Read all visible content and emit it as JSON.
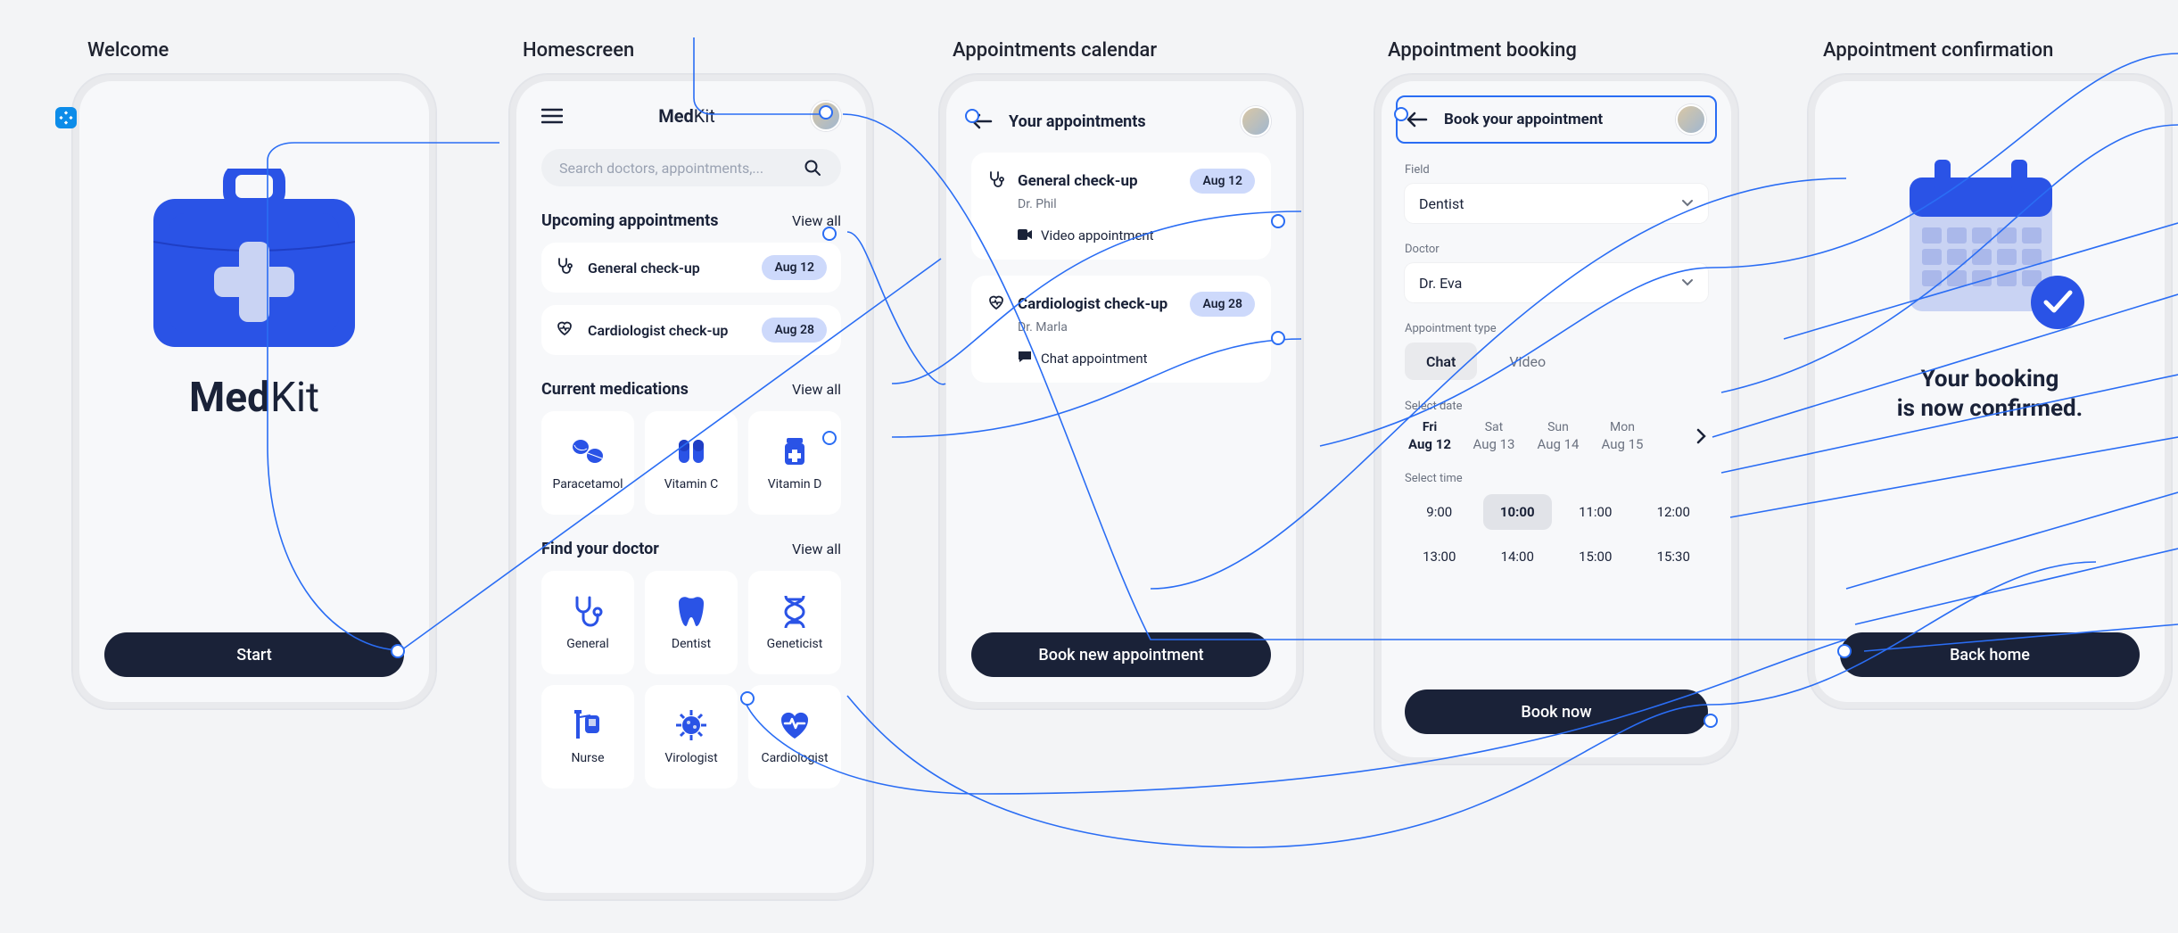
{
  "labels": {
    "welcome": "Welcome",
    "home": "Homescreen",
    "calendar": "Appointments calendar",
    "booking": "Appointment booking",
    "confirm": "Appointment confirmation"
  },
  "brand": {
    "med": "Med",
    "kit": "Kit"
  },
  "welcome": {
    "start": "Start"
  },
  "home": {
    "search_placeholder": "Search doctors, appointments,...",
    "upcoming_title": "Upcoming appointments",
    "view_all": "View all",
    "appt1": {
      "label": "General check-up",
      "date": "Aug 12"
    },
    "appt2": {
      "label": "Cardiologist check-up",
      "date": "Aug 28"
    },
    "meds_title": "Current medications",
    "med1": "Paracetamol",
    "med2": "Vitamin C",
    "med3": "Vitamin D",
    "doctor_title": "Find your doctor",
    "doc1": "General",
    "doc2": "Dentist",
    "doc3": "Geneticist",
    "doc4": "Nurse",
    "doc5": "Virologist",
    "doc6": "Cardiologist"
  },
  "calendar": {
    "title": "Your appointments",
    "c1": {
      "title": "General check-up",
      "doctor": "Dr. Phil",
      "date": "Aug 12",
      "type": "Video appointment"
    },
    "c2": {
      "title": "Cardiologist check-up",
      "doctor": "Dr. Marla",
      "date": "Aug 28",
      "type": "Chat appointment"
    },
    "new_button": "Book new appointment"
  },
  "booking": {
    "title": "Book your appointment",
    "field_label": "Field",
    "field_value": "Dentist",
    "doctor_label": "Doctor",
    "doctor_value": "Dr. Eva",
    "type_label": "Appointment type",
    "type_chat": "Chat",
    "type_video": "Video",
    "date_label": "Select date",
    "dates": [
      {
        "dow": "Fri",
        "day": "Aug 12",
        "selected": true
      },
      {
        "dow": "Sat",
        "day": "Aug 13"
      },
      {
        "dow": "Sun",
        "day": "Aug 14"
      },
      {
        "dow": "Mon",
        "day": "Aug 15"
      }
    ],
    "time_label": "Select time",
    "times": [
      "9:00",
      "10:00",
      "11:00",
      "12:00",
      "13:00",
      "14:00",
      "15:00",
      "15:30"
    ],
    "time_selected_index": 1,
    "submit": "Book now"
  },
  "confirm": {
    "line1": "Your booking",
    "line2": "is now confirmed.",
    "back": "Back home"
  },
  "colors": {
    "primary": "#2a53e6",
    "accent_pill": "#cdd9fb",
    "dark": "#1a2238",
    "flow": "#2a6df4"
  }
}
